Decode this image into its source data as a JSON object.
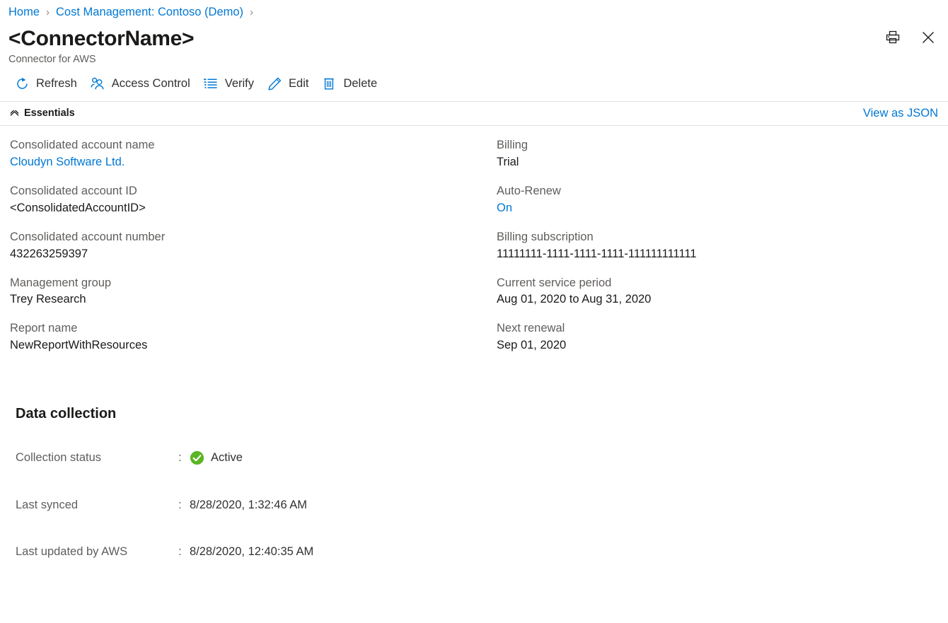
{
  "breadcrumb": {
    "items": [
      {
        "label": "Home",
        "link": true
      },
      {
        "label": "Cost Management: Contoso (Demo)",
        "link": true
      }
    ],
    "separator": "›"
  },
  "header": {
    "title": "<ConnectorName>",
    "subtitle": "Connector for AWS",
    "actions": [
      {
        "name": "print-icon",
        "tooltip": "Print"
      },
      {
        "name": "close-icon",
        "tooltip": "Close"
      }
    ]
  },
  "commandbar": {
    "buttons": [
      {
        "label": "Refresh",
        "icon": "refresh-icon"
      },
      {
        "label": "Access Control",
        "icon": "access-control-icon"
      },
      {
        "label": "Verify",
        "icon": "verify-list-icon"
      },
      {
        "label": "Edit",
        "icon": "pencil-icon"
      },
      {
        "label": "Delete",
        "icon": "trash-icon"
      }
    ]
  },
  "essentials": {
    "toggle_label": "Essentials",
    "chevron": "⌃",
    "json_link": "View as JSON",
    "left": [
      {
        "label": "Consolidated account name",
        "value": "Cloudyn Software Ltd.",
        "is_link": true
      },
      {
        "label": "Consolidated account ID",
        "value": "<ConsolidatedAccountID>",
        "is_link": false
      },
      {
        "label": "Consolidated account number",
        "value": "432263259397",
        "is_link": false
      },
      {
        "label": "Management group",
        "value": "Trey Research",
        "is_link": false
      },
      {
        "label": "Report name",
        "value": "NewReportWithResources",
        "is_link": false
      }
    ],
    "right": [
      {
        "label": "Billing",
        "value": "Trial",
        "is_link": false
      },
      {
        "label": "Auto-Renew",
        "value": "On",
        "is_link": true
      },
      {
        "label": "Billing subscription",
        "value": "11111111-1111-1111-1111-111111111111",
        "is_link": false
      },
      {
        "label": "Current service period",
        "value": "Aug 01, 2020 to Aug 31, 2020",
        "is_link": false
      },
      {
        "label": "Next renewal",
        "value": "Sep 01, 2020",
        "is_link": false
      }
    ]
  },
  "data_collection": {
    "title": "Data collection",
    "colon": ":",
    "rows": [
      {
        "label": "Collection status",
        "value": "Active",
        "status_icon": "success-check-icon"
      },
      {
        "label": "Last synced",
        "value": "8/28/2020, 1:32:46 AM",
        "status_icon": null
      },
      {
        "label": "Last updated by AWS",
        "value": "8/28/2020, 12:40:35 AM",
        "status_icon": null
      }
    ]
  },
  "colors": {
    "accent_blue": "#0078d4",
    "success_green": "#5bb522",
    "text_primary": "#1b1a19",
    "text_secondary": "#605e5c",
    "divider": "#e1dfdd"
  }
}
